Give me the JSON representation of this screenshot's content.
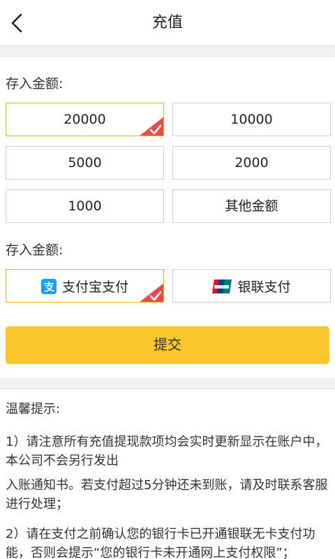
{
  "header": {
    "title": "充值",
    "back_icon": "back-chevron-icon"
  },
  "amount_section": {
    "label": "存入金额:",
    "options": [
      {
        "label": "20000",
        "selected": true
      },
      {
        "label": "10000",
        "selected": false
      },
      {
        "label": "5000",
        "selected": false
      },
      {
        "label": "2000",
        "selected": false
      },
      {
        "label": "1000",
        "selected": false
      },
      {
        "label": "其他金额",
        "selected": false
      }
    ]
  },
  "payment_section": {
    "label": "存入金额:",
    "methods": [
      {
        "label": "支付宝支付",
        "icon": "alipay-icon",
        "selected": true
      },
      {
        "label": "银联支付",
        "icon": "unionpay-icon",
        "selected": false
      }
    ]
  },
  "submit_label": "提交",
  "tips": {
    "heading": "温馨提示:",
    "items": [
      "1）请注意所有充值提现款项均会实时更新显示在账户中，本公司不会另行发出",
      "入账通知书。若支付超过5分钟还未到账，请及时联系客服进行处理；",
      "2）请在支付之前确认您的银行卡已开通银联无卡支付功能，否则会提示“您的银行卡未开通网上支付权限”；"
    ]
  },
  "colors": {
    "accent": "#fcc62d",
    "selected_border": "#f5b400",
    "check_badge": "#e84a4a",
    "alipay_blue": "#1a9ff0"
  }
}
